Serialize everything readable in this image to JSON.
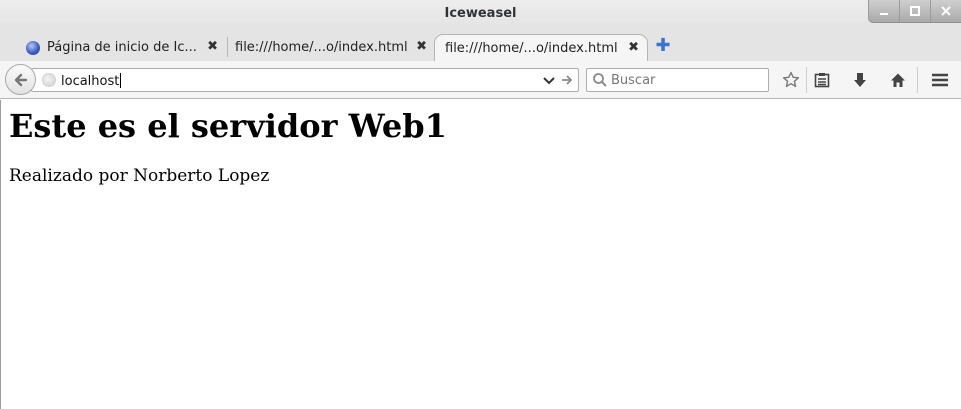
{
  "window": {
    "title": "Iceweasel"
  },
  "tabs": [
    {
      "label": "Página de inicio de Ic...",
      "close": "✖"
    },
    {
      "label": "file:///home/...o/index.html",
      "close": "✖"
    },
    {
      "label": "file:///home/...o/index.html",
      "close": "✖",
      "selected": true
    }
  ],
  "newtab": {
    "symbol": "✚"
  },
  "navbar": {
    "url_value": "localhost",
    "search_placeholder": "Buscar"
  },
  "page": {
    "heading": "Este es el servidor Web1",
    "paragraph": "Realizado por Norberto Lopez"
  },
  "icons": {
    "back": "back-arrow-icon",
    "globe": "globe-icon",
    "dropmarker": "chevron-down-icon",
    "go": "go-arrow-icon",
    "search": "magnifier-icon",
    "bookmark": "star-icon",
    "reading_list": "clipboard-list-icon",
    "downloads": "download-arrow-icon",
    "home": "home-icon",
    "menu": "hamburger-menu-icon"
  },
  "colors": {
    "accent": "#3b73d1",
    "chrome": "#e4e4e4",
    "toolbar": "#f5f5f5"
  }
}
